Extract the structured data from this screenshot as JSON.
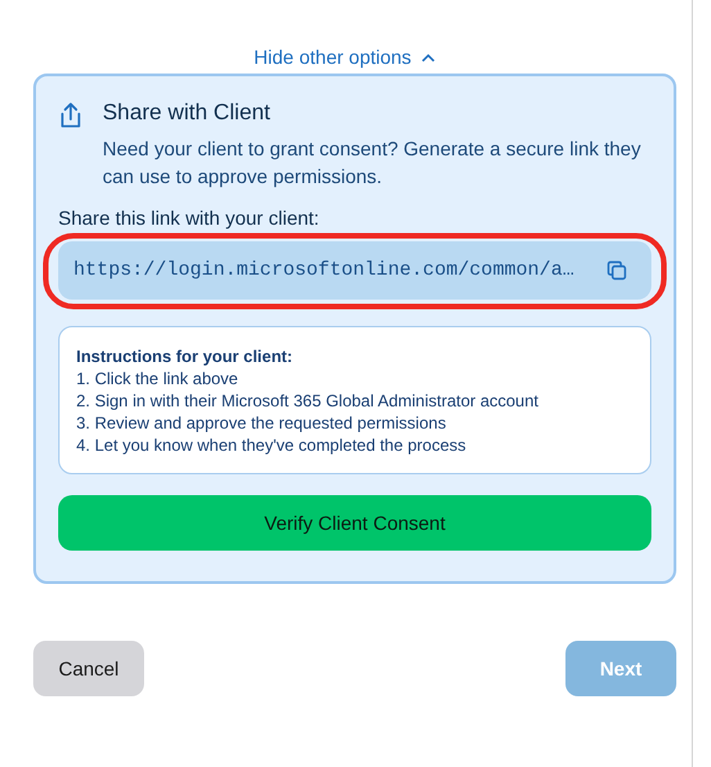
{
  "toggle": {
    "label": "Hide other options",
    "expanded": true
  },
  "share_card": {
    "title": "Share with Client",
    "description": "Need your client to grant consent? Generate a secure link they can use to approve permissions.",
    "link_label": "Share this link with your client:",
    "link_field": {
      "value": "https://login.microsoftonline.com/common/a…",
      "highlighted": true
    },
    "instructions": {
      "heading": "Instructions for your client:",
      "steps": [
        "1. Click the link above",
        "2. Sign in with their Microsoft 365 Global Administrator account",
        "3. Review and approve the requested permissions",
        "4. Let you know when they've completed the process"
      ]
    },
    "verify_button": "Verify Client Consent"
  },
  "footer": {
    "buttons": [
      {
        "label": "Cancel",
        "kind": "secondary",
        "disabled": false
      },
      {
        "label": "Next",
        "kind": "primary",
        "disabled": true
      }
    ]
  }
}
